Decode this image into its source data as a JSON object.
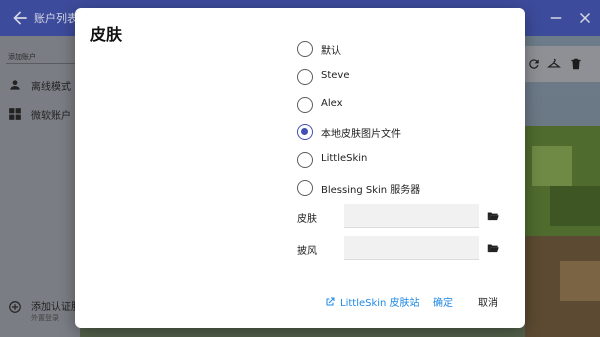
{
  "window": {
    "title": "账户列表",
    "icons": {
      "back": "arrow-back-icon",
      "minimize": "minimize-icon",
      "close": "close-icon"
    }
  },
  "sidebar": {
    "caption": "添加账户",
    "items": [
      {
        "label": "离线模式",
        "icon": "person-icon"
      },
      {
        "label": "微软账户",
        "icon": "windows-logo-icon"
      }
    ],
    "add_auth": {
      "label": "添加认证服",
      "sublabel": "外置登录",
      "icon": "add-circle-icon"
    }
  },
  "account_card": {
    "icons": [
      "refresh-icon",
      "hanger-icon",
      "delete-icon"
    ]
  },
  "dialog": {
    "title": "皮肤",
    "options": [
      {
        "label": "默认",
        "checked": false
      },
      {
        "label": "Steve",
        "checked": false
      },
      {
        "label": "Alex",
        "checked": false
      },
      {
        "label": "本地皮肤图片文件",
        "checked": true
      },
      {
        "label": "LittleSkin",
        "checked": false
      },
      {
        "label": "Blessing Skin 服务器",
        "checked": false
      }
    ],
    "fields": {
      "skin": {
        "label": "皮肤",
        "value": ""
      },
      "cape": {
        "label": "披风",
        "value": ""
      }
    },
    "actions": {
      "link": "LittleSkin 皮肤站",
      "ok": "确定",
      "cancel": "取消"
    }
  },
  "colors": {
    "titlebar": "#3d4b9c",
    "accent": "#3f51b5",
    "link": "#1e88e5"
  }
}
